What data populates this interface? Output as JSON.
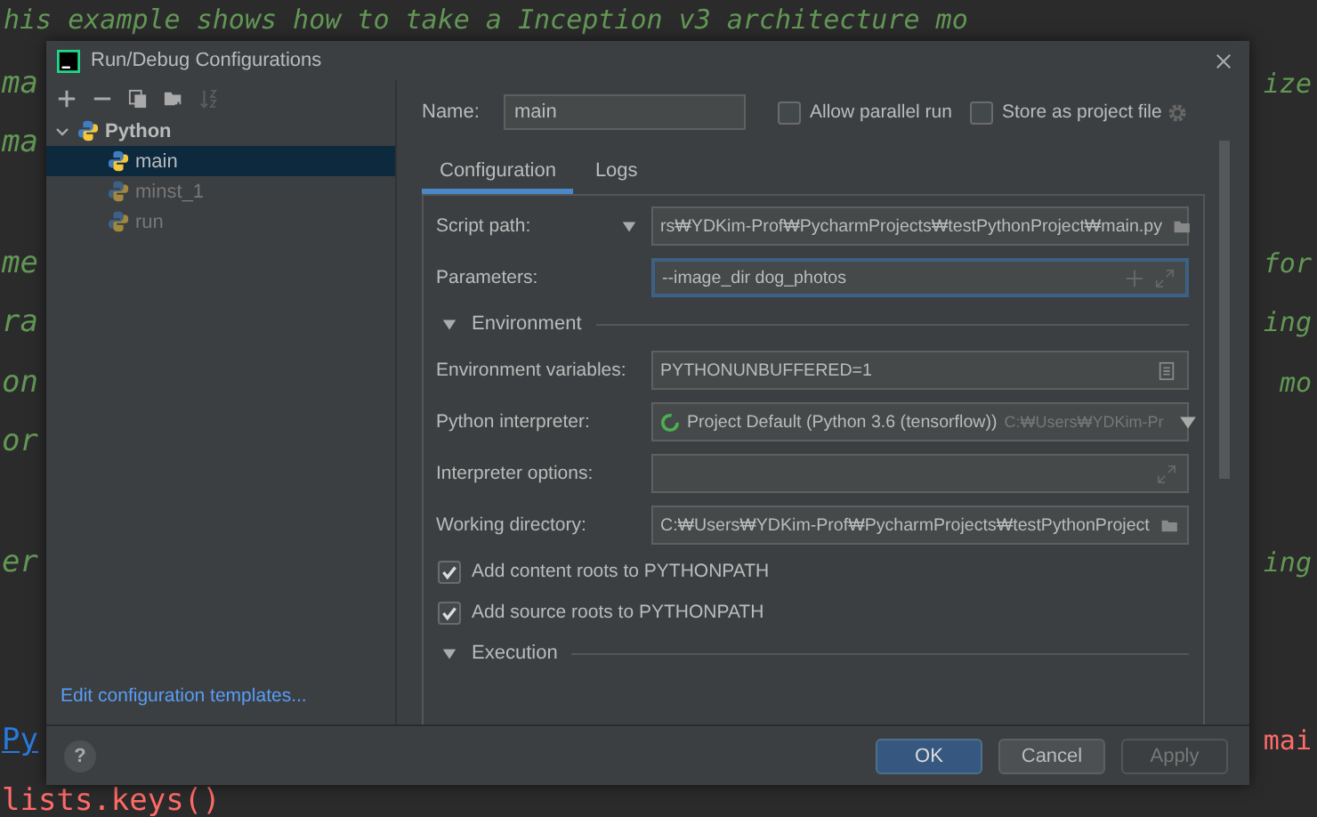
{
  "editor": {
    "lines": [
      {
        "kind": "code",
        "left": {
          "text": "his example shows how to take a Inception v3 architecture mo",
          "kind": "comment"
        }
      },
      {
        "kind": "code",
        "left": {
          "text": "ma",
          "kind": "comment"
        },
        "right": {
          "text": "ize",
          "kind": "comment"
        }
      },
      {
        "kind": "code",
        "left": {
          "text": "ma",
          "kind": "comment"
        }
      },
      {
        "kind": "blank"
      },
      {
        "kind": "code",
        "left": {
          "text": "me",
          "kind": "comment"
        },
        "right": {
          "text": "for",
          "kind": "comment"
        }
      },
      {
        "kind": "code",
        "left": {
          "text": "ra",
          "kind": "comment"
        },
        "right": {
          "text": "ing",
          "kind": "comment"
        }
      },
      {
        "kind": "code",
        "left": {
          "text": "on",
          "kind": "comment"
        },
        "right": {
          "text": "mo",
          "kind": "comment"
        }
      },
      {
        "kind": "code",
        "left": {
          "text": "or",
          "kind": "comment"
        }
      },
      {
        "kind": "blank"
      },
      {
        "kind": "code",
        "left": {
          "text": "er",
          "kind": "comment"
        },
        "right": {
          "text": "ing",
          "kind": "comment"
        }
      },
      {
        "kind": "blank"
      },
      {
        "kind": "blank"
      },
      {
        "kind": "code",
        "left": {
          "text": "Py",
          "kind": "link"
        },
        "right": {
          "text": "mai",
          "kind": "string"
        }
      },
      {
        "kind": "code",
        "left": {
          "text": "lists.keys()",
          "kind": "string"
        }
      }
    ]
  },
  "dialog": {
    "title": "Run/Debug Configurations",
    "toolbar": [
      {
        "kind": "add",
        "disabled": false
      },
      {
        "kind": "remove",
        "disabled": false
      },
      {
        "kind": "copy",
        "disabled": false
      },
      {
        "kind": "folder",
        "disabled": false
      },
      {
        "kind": "sort",
        "disabled": true
      }
    ],
    "tree": {
      "label": "Python",
      "expanded": true,
      "children": [
        {
          "label": "main",
          "selected": true,
          "temporary": false
        },
        {
          "label": "minst_1",
          "selected": false,
          "temporary": true
        },
        {
          "label": "run",
          "selected": false,
          "temporary": true
        }
      ]
    },
    "templates_link": "Edit configuration templates...",
    "name": {
      "label": "Name:",
      "value": "main"
    },
    "options": [
      {
        "label": "Allow parallel run",
        "checked": false
      },
      {
        "label": "Store as project file",
        "checked": false
      }
    ],
    "tabs": [
      {
        "label": "Configuration",
        "selected": true
      },
      {
        "label": "Logs",
        "selected": false
      }
    ],
    "items": [
      {
        "kind": "field",
        "label": "Script path:",
        "label_dropdown": true,
        "value": "rs₩YDKim-Prof₩PycharmProjects₩testPythonProject₩main.py",
        "actions": [
          {
            "kind": "folder"
          }
        ],
        "focused": false
      },
      {
        "kind": "field",
        "label": "Parameters:",
        "label_dropdown": false,
        "value": "--image_dir dog_photos",
        "actions": [
          {
            "kind": "add"
          },
          {
            "kind": "expand"
          }
        ],
        "focused": true
      },
      {
        "kind": "section",
        "label": "Environment",
        "expanded": true
      },
      {
        "kind": "field",
        "label": "Environment variables:",
        "label_dropdown": false,
        "value": "PYTHONUNBUFFERED=1",
        "actions": [
          {
            "kind": "list"
          }
        ],
        "focused": false
      },
      {
        "kind": "interpreter",
        "label": "Python interpreter:",
        "value": "Project Default (Python 3.6 (tensorflow))",
        "hint": "C:₩Users₩YDKim-Pr"
      },
      {
        "kind": "field",
        "label": "Interpreter options:",
        "label_dropdown": false,
        "actions": [
          {
            "kind": "expand"
          }
        ],
        "focused": false
      },
      {
        "kind": "field",
        "label": "Working directory:",
        "label_dropdown": false,
        "value": "C:₩Users₩YDKim-Prof₩PycharmProjects₩testPythonProject",
        "actions": [
          {
            "kind": "folder"
          }
        ],
        "focused": false
      },
      {
        "kind": "checkbox",
        "label": "Add content roots to PYTHONPATH",
        "checked": true
      },
      {
        "kind": "checkbox",
        "label": "Add source roots to PYTHONPATH",
        "checked": true
      },
      {
        "kind": "section",
        "label": "Execution",
        "expanded": true
      }
    ],
    "help": "?",
    "buttons": [
      {
        "label": "OK",
        "kind": "primary",
        "disabled": false
      },
      {
        "label": "Cancel",
        "kind": "normal",
        "disabled": false
      },
      {
        "label": "Apply",
        "kind": "normal",
        "disabled": true
      }
    ]
  }
}
